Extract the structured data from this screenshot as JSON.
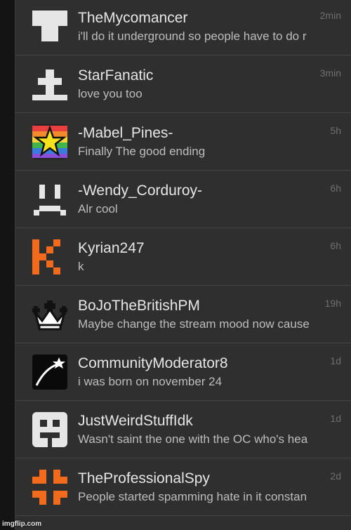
{
  "conversations": [
    {
      "name": "TheMycomancer",
      "message": "i'll do it underground so people have to do r",
      "time": "2min",
      "avatar_icon": "mushroom-icon"
    },
    {
      "name": "StarFanatic",
      "message": "love you too",
      "time": "3min",
      "avatar_icon": "gravestone-cross-icon"
    },
    {
      "name": "-Mabel_Pines-",
      "message": "Finally The good ending",
      "time": "5h",
      "avatar_icon": "rainbow-star-icon"
    },
    {
      "name": "-Wendy_Corduroy-",
      "message": "Alr cool",
      "time": "6h",
      "avatar_icon": "frown-face-icon"
    },
    {
      "name": "Kyrian247",
      "message": "k",
      "time": "6h",
      "avatar_icon": "letter-k-icon"
    },
    {
      "name": "BoJoTheBritishPM",
      "message": "Maybe change the stream mood now cause",
      "time": "19h",
      "avatar_icon": "crown-icon"
    },
    {
      "name": "CommunityModerator8",
      "message": "i was born on november 24",
      "time": "1d",
      "avatar_icon": "shooting-star-icon"
    },
    {
      "name": "JustWeirdStuffIdk",
      "message": "Wasn't saint the one with the OC who's hea",
      "time": "1d",
      "avatar_icon": "block-face-icon"
    },
    {
      "name": "TheProfessionalSpy",
      "message": "People started spamming hate in it constan",
      "time": "2d",
      "avatar_icon": "corners-icon"
    }
  ],
  "watermark": "imgflip.com",
  "colors": {
    "background": "#2f2f2f",
    "name_text": "#e6e6e6",
    "message_text": "#bdbdbd",
    "time_text": "#6f6f6f",
    "accent_orange": "#f26b1d"
  }
}
